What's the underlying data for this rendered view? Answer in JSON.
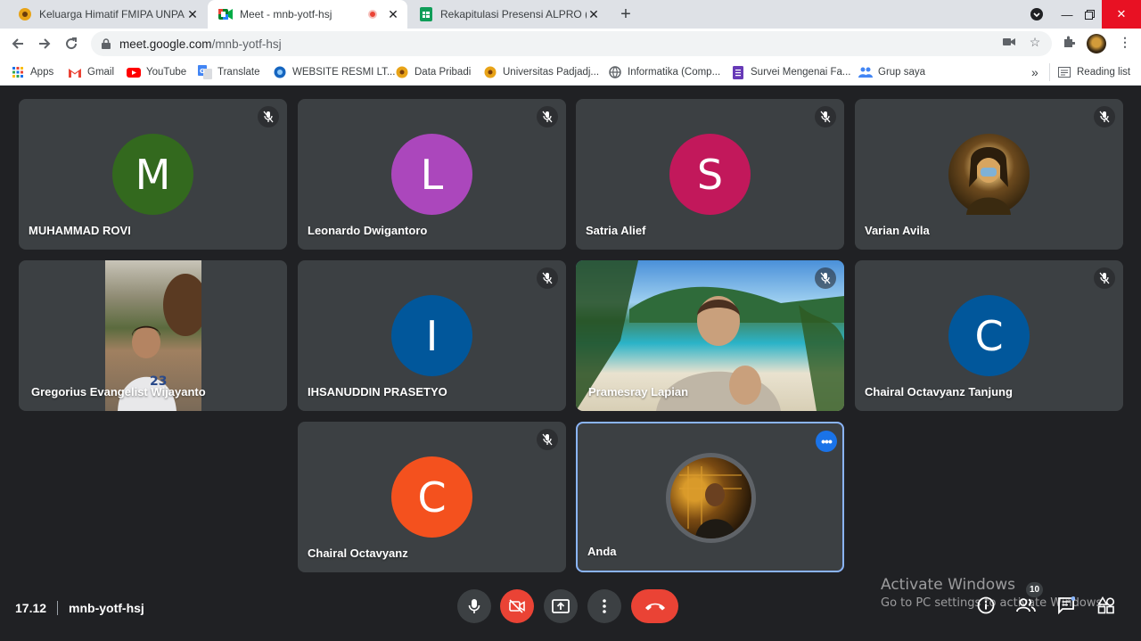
{
  "browser": {
    "tabs": [
      {
        "title": "Keluarga Himatif FMIPA UNPAD",
        "active": false
      },
      {
        "title": "Meet - mnb-yotf-hsj",
        "active": true,
        "recording": true
      },
      {
        "title": "Rekapitulasi Presensi ALPRO (B)",
        "active": false
      }
    ],
    "url_host": "meet.google.com",
    "url_path": "/mnb-yotf-hsj",
    "bookmarks": [
      {
        "label": "Apps",
        "icon": "apps-grid-icon"
      },
      {
        "label": "Gmail",
        "icon": "gmail-icon"
      },
      {
        "label": "YouTube",
        "icon": "youtube-icon"
      },
      {
        "label": "Translate",
        "icon": "translate-icon"
      },
      {
        "label": "WEBSITE RESMI LT...",
        "icon": "globe-icon"
      },
      {
        "label": "Data Pribadi",
        "icon": "unpad-icon"
      },
      {
        "label": "Universitas Padjadj...",
        "icon": "unpad-icon"
      },
      {
        "label": "Informatika (Comp...",
        "icon": "globe-icon"
      },
      {
        "label": "Survei Mengenai Fa...",
        "icon": "forms-icon"
      },
      {
        "label": "Grup saya",
        "icon": "people-icon"
      }
    ],
    "reading_list": "Reading list",
    "overflow": "»"
  },
  "participants": [
    {
      "name": "MUHAMMAD ROVI",
      "initial": "M",
      "color": "#33691e",
      "muted": true
    },
    {
      "name": "Leonardo Dwigantoro",
      "initial": "L",
      "color": "#ab47bc",
      "muted": true
    },
    {
      "name": "Satria Alief",
      "initial": "S",
      "color": "#c2185b",
      "muted": true
    },
    {
      "name": "Varian Avila",
      "initial": "",
      "color": "#7a5c2e",
      "muted": true,
      "photo": "mona-lisa-avatar"
    },
    {
      "name": "Gregorius Evangelist Wijayanto",
      "initial": "",
      "color": "#6b5a45",
      "muted": false,
      "video": true
    },
    {
      "name": "IHSANUDDIN PRASETYO",
      "initial": "I",
      "color": "#01579b",
      "muted": true
    },
    {
      "name": "Pramesray Lapian",
      "initial": "",
      "color": "#2e7d9a",
      "muted": true,
      "video": true
    },
    {
      "name": "Chairal Octavyanz Tanjung",
      "initial": "C",
      "color": "#01579b",
      "muted": true
    },
    {
      "name": "Chairal Octavyanz",
      "initial": "C",
      "color": "#f4511e",
      "muted": true
    },
    {
      "name": "Anda",
      "initial": "",
      "color": "#3b2a12",
      "muted": false,
      "self": true
    }
  ],
  "meeting": {
    "time": "17.12",
    "code": "mnb-yotf-hsj",
    "participant_count": "10"
  },
  "watermark": {
    "line1": "Activate Windows",
    "line2": "Go to PC settings to activate Windows."
  },
  "colors": {
    "end_call": "#ea4335",
    "tile_bg": "#3c4043",
    "stage_bg": "#202124",
    "self_border": "#8ab4f8"
  }
}
